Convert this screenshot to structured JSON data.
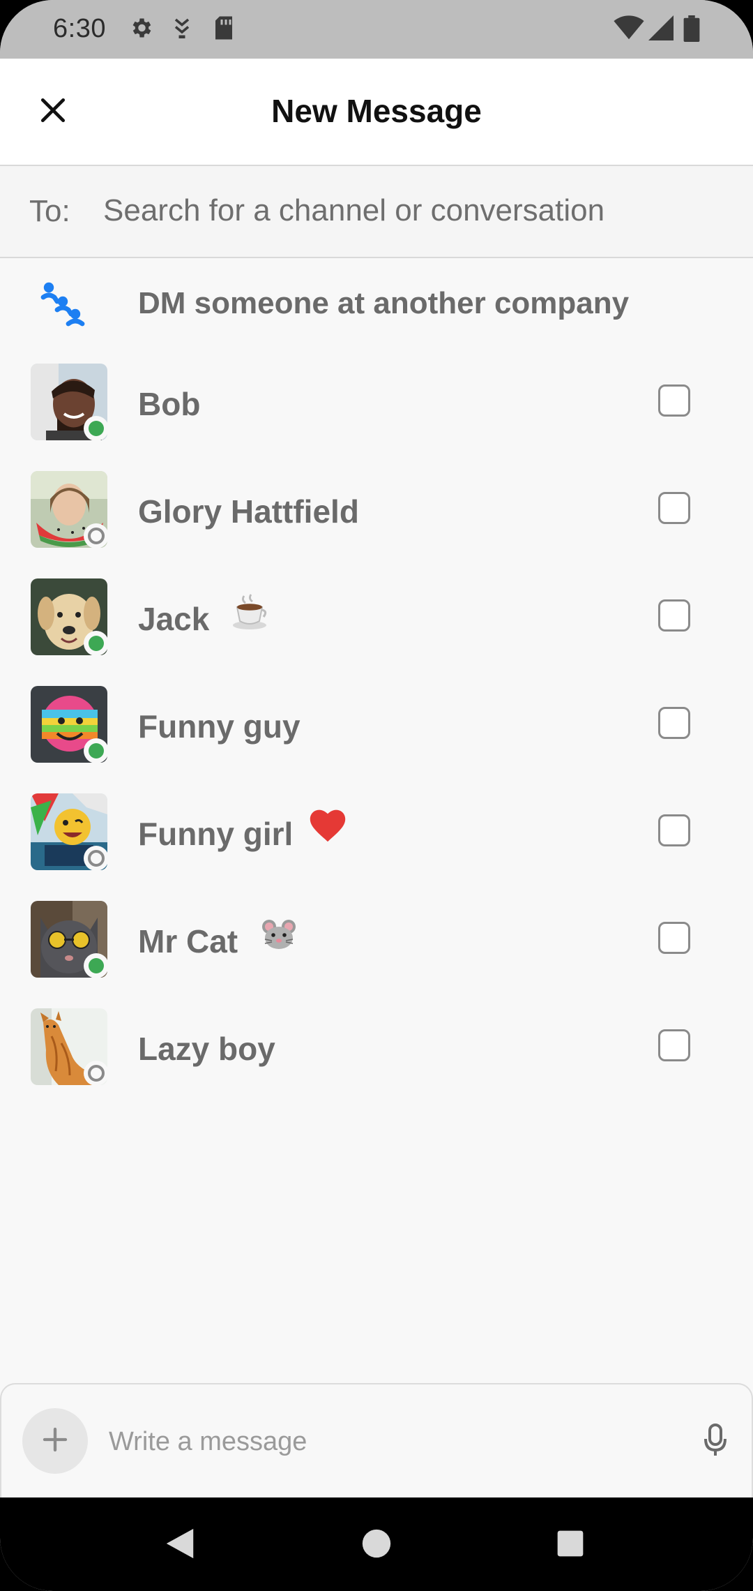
{
  "status_bar": {
    "time": "6:30",
    "icons": [
      "settings-icon",
      "download-icon",
      "sd-card-icon",
      "wifi-icon",
      "signal-icon",
      "battery-icon"
    ]
  },
  "app_bar": {
    "title": "New Message",
    "close_icon": "close-icon"
  },
  "to_field": {
    "label": "To:",
    "placeholder": "Search for a channel or conversation"
  },
  "dm_external": {
    "label": "DM someone at another company",
    "icon": "shared-channel-icon",
    "accent_color": "#1d7ff2"
  },
  "contacts": [
    {
      "name": "Bob",
      "status": "active",
      "emoji": ""
    },
    {
      "name": "Glory Hattfield",
      "status": "away",
      "emoji": ""
    },
    {
      "name": "Jack",
      "status": "active",
      "emoji": "coffee-icon"
    },
    {
      "name": "Funny guy",
      "status": "active",
      "emoji": ""
    },
    {
      "name": "Funny girl",
      "status": "away",
      "emoji": "heart-icon"
    },
    {
      "name": "Mr Cat",
      "status": "active",
      "emoji": "mouse-icon"
    },
    {
      "name": "Lazy boy",
      "status": "away",
      "emoji": ""
    }
  ],
  "composer": {
    "placeholder": "Write a message",
    "plus_icon": "plus-icon",
    "mic_icon": "microphone-icon"
  },
  "nav_bar": {
    "icons": [
      "back-icon",
      "home-icon",
      "recents-icon"
    ]
  },
  "colors": {
    "status_active": "#3da854",
    "status_away": "#8a8a8a",
    "status_bar_bg": "#bdbdbd"
  }
}
